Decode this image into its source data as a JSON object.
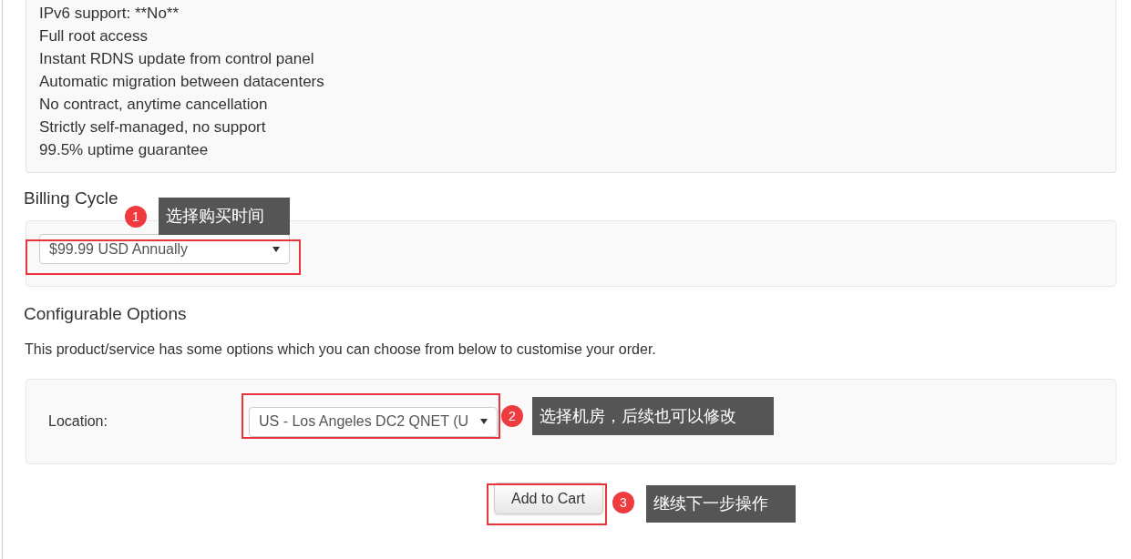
{
  "features": [
    "IPv6 support: **No**",
    "Full root access",
    "Instant RDNS update from control panel",
    "Automatic migration between datacenters",
    "No contract, anytime cancellation",
    "Strictly self-managed, no support",
    "99.5% uptime guarantee"
  ],
  "billing": {
    "heading": "Billing Cycle",
    "value": "$99.99 USD Annually"
  },
  "configurable": {
    "heading": "Configurable Options",
    "description": "This product/service has some options which you can choose from below to customise your order.",
    "location_label": "Location:",
    "location_value": "US - Los Angeles DC2 QNET (U"
  },
  "add_button": "Add to Cart",
  "annotations": [
    {
      "number": "1",
      "text": "选择购买时间"
    },
    {
      "number": "2",
      "text": "选择机房，后续也可以修改"
    },
    {
      "number": "3",
      "text": "继续下一步操作"
    }
  ]
}
